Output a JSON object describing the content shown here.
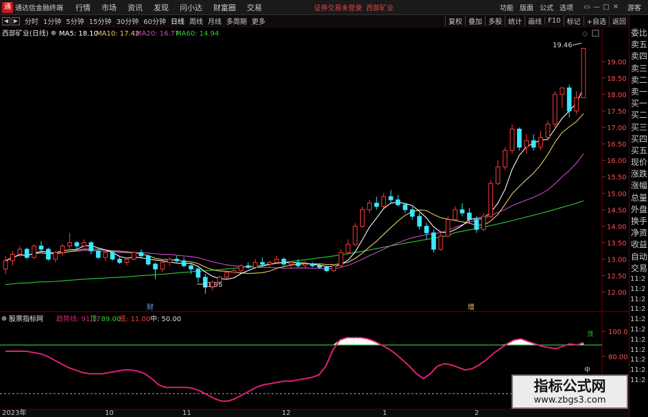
{
  "app": {
    "title": "通达信金融终端",
    "logo_glyph": "通"
  },
  "menu": [
    "行情",
    "市场",
    "资讯",
    "发现",
    "问小达",
    "财富圈",
    "交易"
  ],
  "notice": "证券交易未登录",
  "stock_tag": "西部矿业",
  "right_menu": [
    "功能",
    "版面",
    "公式",
    "选项"
  ],
  "window_controls": [
    "▭",
    "—",
    "□",
    "✕"
  ],
  "guest": "游客",
  "periods": [
    "分时",
    "1分钟",
    "5分钟",
    "15分钟",
    "30分钟",
    "60分钟",
    "日线",
    "周线",
    "月线",
    "多周期",
    "更多"
  ],
  "active_period": "日线",
  "tools": [
    "复权",
    "叠加",
    "多股",
    "统计",
    "画线",
    "F10",
    "标记",
    "+自选",
    "返回"
  ],
  "main_legend": {
    "name": "西部矿业(日线)",
    "ma5": "MA5: 18.10",
    "ma10": "MA10: 17.42",
    "ma20": "MA20: 16.77",
    "ma60": "MA60: 14.94"
  },
  "price_ticks": [
    "19.00",
    "18.50",
    "18.00",
    "17.50",
    "17.00",
    "16.50",
    "16.00",
    "15.50",
    "15.00",
    "14.50",
    "14.00",
    "13.50",
    "13.00",
    "12.50",
    "12.00"
  ],
  "annotations": {
    "high": "19.46",
    "low": "11.95",
    "cai": "财",
    "zeng": "增"
  },
  "sub_legend": {
    "name": "股票指标网",
    "trend": "趋势线: 91.17",
    "top": "顶: 89.00",
    "bottom": "底: 11.00",
    "mid": "中: 50.00"
  },
  "sub_ticks": [
    "100.0",
    "80.00",
    "60.00"
  ],
  "sub_marks": {
    "top": "顶",
    "mid": "中"
  },
  "dates": [
    "2023年",
    "10",
    "11",
    "12",
    "1",
    "2"
  ],
  "right_panel": [
    "委比",
    "卖五",
    "卖四",
    "卖三",
    "卖二",
    "卖一",
    "买一",
    "买二",
    "买三",
    "买四",
    "买五",
    "现价",
    "涨跌",
    "涨幅",
    "总量",
    "外盘",
    "换手",
    "净资",
    "收益",
    "自动",
    "交易"
  ],
  "right_times": [
    "11:2",
    "11:2",
    "11:2",
    "11:2",
    "11:2",
    "11:2",
    "11:2",
    "11:2",
    "11:2",
    "11:2",
    "11:2"
  ],
  "watermark": {
    "title": "指标公式网",
    "url": "www.zbgs3.com"
  },
  "colors": {
    "up": "#ff3b3b",
    "down": "#3ce6ff",
    "ma5": "#ffffff",
    "ma10": "#e8d068",
    "ma20": "#d048d0",
    "ma60": "#30d030",
    "trend": "#e0207a",
    "top_line": "#30c030"
  },
  "chart_data": [
    {
      "type": "candlestick",
      "title": "西部矿业(日线)",
      "ylim": [
        11.7,
        19.6
      ],
      "series": [
        {
          "name": "MA5",
          "last": 18.1
        },
        {
          "name": "MA10",
          "last": 17.42
        },
        {
          "name": "MA20",
          "last": 16.77
        },
        {
          "name": "MA60",
          "last": 14.94
        }
      ],
      "candles": [
        [
          12.7,
          13.1,
          12.55,
          12.95
        ],
        [
          12.95,
          13.25,
          12.8,
          13.15
        ],
        [
          13.15,
          13.4,
          13.05,
          13.3
        ],
        [
          13.3,
          13.35,
          13.0,
          13.05
        ],
        [
          13.05,
          13.45,
          13.0,
          13.4
        ],
        [
          13.4,
          13.55,
          13.2,
          13.3
        ],
        [
          13.3,
          13.35,
          12.95,
          13.0
        ],
        [
          13.0,
          13.25,
          12.9,
          13.2
        ],
        [
          13.2,
          13.45,
          13.1,
          13.4
        ],
        [
          13.4,
          13.8,
          13.3,
          13.5
        ],
        [
          13.5,
          13.55,
          13.3,
          13.4
        ],
        [
          13.4,
          13.6,
          13.35,
          13.5
        ],
        [
          13.5,
          13.55,
          13.15,
          13.25
        ],
        [
          13.25,
          13.3,
          13.0,
          13.05
        ],
        [
          13.05,
          13.25,
          12.95,
          13.2
        ],
        [
          13.2,
          13.25,
          12.95,
          13.0
        ],
        [
          13.0,
          13.1,
          12.85,
          12.9
        ],
        [
          12.9,
          13.05,
          12.8,
          13.0
        ],
        [
          13.0,
          13.25,
          12.95,
          13.2
        ],
        [
          13.2,
          13.3,
          13.05,
          13.1
        ],
        [
          13.1,
          13.15,
          12.8,
          12.85
        ],
        [
          12.85,
          12.9,
          12.4,
          12.7
        ],
        [
          12.7,
          12.95,
          12.6,
          12.9
        ],
        [
          12.9,
          13.05,
          12.8,
          13.0
        ],
        [
          13.0,
          13.1,
          12.9,
          12.95
        ],
        [
          12.95,
          13.05,
          12.75,
          12.8
        ],
        [
          12.8,
          12.85,
          12.55,
          12.7
        ],
        [
          12.7,
          12.75,
          12.3,
          12.45
        ],
        [
          12.45,
          12.55,
          11.95,
          12.15
        ],
        [
          12.15,
          12.35,
          12.05,
          12.3
        ],
        [
          12.3,
          12.5,
          12.2,
          12.45
        ],
        [
          12.45,
          12.65,
          12.4,
          12.6
        ],
        [
          12.6,
          12.7,
          12.55,
          12.65
        ],
        [
          12.65,
          12.85,
          12.6,
          12.8
        ],
        [
          12.8,
          12.9,
          12.7,
          12.75
        ],
        [
          12.75,
          13.0,
          12.7,
          12.9
        ],
        [
          12.9,
          13.05,
          12.8,
          12.85
        ],
        [
          12.85,
          12.95,
          12.75,
          12.9
        ],
        [
          12.9,
          13.1,
          12.85,
          13.0
        ],
        [
          13.0,
          13.05,
          12.8,
          12.85
        ],
        [
          12.85,
          12.95,
          12.7,
          12.9
        ],
        [
          12.9,
          13.0,
          12.75,
          12.8
        ],
        [
          12.8,
          12.95,
          12.7,
          12.85
        ],
        [
          12.85,
          12.9,
          12.75,
          12.8
        ],
        [
          12.8,
          12.85,
          12.7,
          12.75
        ],
        [
          12.75,
          12.8,
          12.6,
          12.65
        ],
        [
          12.65,
          12.85,
          12.6,
          12.8
        ],
        [
          12.8,
          13.3,
          12.75,
          13.2
        ],
        [
          13.2,
          13.6,
          13.15,
          13.45
        ],
        [
          13.45,
          14.1,
          13.4,
          14.0
        ],
        [
          14.0,
          14.6,
          13.95,
          14.5
        ],
        [
          14.5,
          14.8,
          14.4,
          14.7
        ],
        [
          14.7,
          14.9,
          14.5,
          14.6
        ],
        [
          14.6,
          15.0,
          14.55,
          14.9
        ],
        [
          14.9,
          15.1,
          14.7,
          14.8
        ],
        [
          14.8,
          14.95,
          14.6,
          14.65
        ],
        [
          14.65,
          14.7,
          14.4,
          14.5
        ],
        [
          14.5,
          14.6,
          14.2,
          14.3
        ],
        [
          14.3,
          14.4,
          13.9,
          14.0
        ],
        [
          14.0,
          14.1,
          13.6,
          13.8
        ],
        [
          13.8,
          13.9,
          13.2,
          13.3
        ],
        [
          13.3,
          13.8,
          13.25,
          13.7
        ],
        [
          13.7,
          14.3,
          13.65,
          14.2
        ],
        [
          14.2,
          14.6,
          14.15,
          14.5
        ],
        [
          14.5,
          14.7,
          14.3,
          14.4
        ],
        [
          14.4,
          14.55,
          14.1,
          14.2
        ],
        [
          14.2,
          14.3,
          13.8,
          13.9
        ],
        [
          13.9,
          14.4,
          13.85,
          14.3
        ],
        [
          14.3,
          15.4,
          14.25,
          15.3
        ],
        [
          15.3,
          16.0,
          15.25,
          15.8
        ],
        [
          15.8,
          16.4,
          15.7,
          16.3
        ],
        [
          16.3,
          17.1,
          16.2,
          16.95
        ],
        [
          16.95,
          17.0,
          16.3,
          16.4
        ],
        [
          16.4,
          16.8,
          16.2,
          16.6
        ],
        [
          16.6,
          16.8,
          16.3,
          16.4
        ],
        [
          16.4,
          16.9,
          16.3,
          16.7
        ],
        [
          16.7,
          17.2,
          16.6,
          17.1
        ],
        [
          17.1,
          18.1,
          17.0,
          18.0
        ],
        [
          18.0,
          18.2,
          17.6,
          18.2
        ],
        [
          18.2,
          18.3,
          17.3,
          17.5
        ],
        [
          17.5,
          18.1,
          17.4,
          17.9
        ],
        [
          17.9,
          19.4,
          17.9,
          19.4
        ]
      ]
    },
    {
      "type": "line",
      "title": "股票指标网",
      "ylim": [
        40,
        106
      ],
      "series": [
        {
          "name": "趋势线",
          "last": 91.17
        }
      ],
      "reference_lines": [
        {
          "name": "顶",
          "value": 89.0
        },
        {
          "name": "底",
          "value": 11.0
        },
        {
          "name": "中",
          "value": 50.0
        }
      ],
      "trend": [
        84,
        84,
        84,
        84,
        83,
        82,
        80,
        77,
        74,
        71,
        69,
        67,
        66,
        66,
        66,
        67,
        68,
        69,
        69,
        68,
        66,
        62,
        57,
        55,
        55,
        55,
        55,
        54,
        52,
        49,
        46,
        44,
        44,
        46,
        49,
        52,
        55,
        57,
        58,
        59,
        60,
        60,
        61,
        62,
        63,
        65,
        72,
        85,
        93,
        95,
        95,
        95,
        94,
        92,
        89,
        86,
        82,
        77,
        72,
        66,
        62,
        66,
        72,
        74,
        73,
        71,
        69,
        70,
        73,
        77,
        82,
        86,
        90,
        93,
        94,
        92,
        90,
        88,
        87,
        86,
        88,
        90,
        89,
        91
      ]
    }
  ]
}
